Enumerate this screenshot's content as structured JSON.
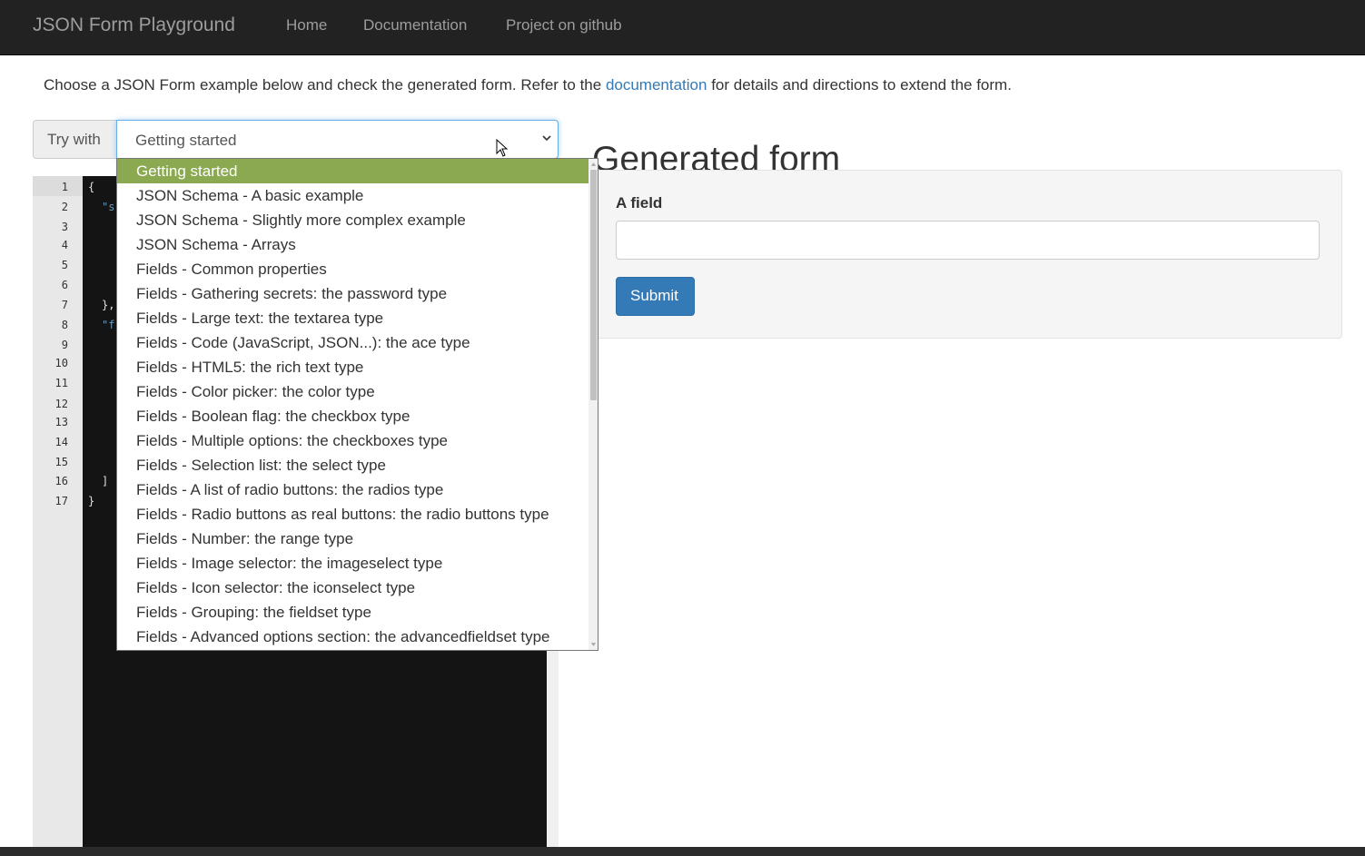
{
  "navbar": {
    "brand": "JSON Form Playground",
    "links": [
      "Home",
      "Documentation",
      "Project on github"
    ]
  },
  "intro": {
    "before": "Choose a JSON Form example below and check the generated form. Refer to the ",
    "link": "documentation",
    "after": " for details and directions to extend the form."
  },
  "selector": {
    "addon_label": "Try with",
    "selected": "Getting started",
    "options": [
      "Getting started",
      "JSON Schema - A basic example",
      "JSON Schema - Slightly more complex example",
      "JSON Schema - Arrays",
      "Fields - Common properties",
      "Fields - Gathering secrets: the password type",
      "Fields - Large text: the textarea type",
      "Fields - Code (JavaScript, JSON...): the ace type",
      "Fields - HTML5: the rich text type",
      "Fields - Color picker: the color type",
      "Fields - Boolean flag: the checkbox type",
      "Fields - Multiple options: the checkboxes type",
      "Fields - Selection list: the select type",
      "Fields - A list of radio buttons: the radios type",
      "Fields - Radio buttons as real buttons: the radio buttons type",
      "Fields - Number: the range type",
      "Fields - Image selector: the imageselect type",
      "Fields - Icon selector: the iconselect type",
      "Fields - Grouping: the fieldset type",
      "Fields - Advanced options section: the advancedfieldset type"
    ]
  },
  "editor": {
    "line_numbers": [
      "1",
      "2",
      "3",
      "4",
      "5",
      "6",
      "7",
      "8",
      "9",
      "10",
      "11",
      "12",
      "13",
      "14",
      "15",
      "16",
      "17"
    ],
    "visible_code": [
      {
        "line": 1,
        "text": "{",
        "kind": "plain"
      },
      {
        "line": 2,
        "text": "\"s",
        "kind": "str"
      },
      {
        "line": 7,
        "text": "},",
        "kind": "plain"
      },
      {
        "line": 8,
        "text": "\"f",
        "kind": "str"
      },
      {
        "line": 16,
        "text": "]",
        "kind": "plain"
      },
      {
        "line": 17,
        "text": "}",
        "kind": "plain"
      }
    ]
  },
  "generated": {
    "title": "Generated form",
    "field_label": "A field",
    "field_value": "",
    "submit_label": "Submit"
  },
  "colors": {
    "navbar_bg": "#222222",
    "link": "#337ab7",
    "selected_option": "#8aa950",
    "submit": "#337ab7"
  }
}
